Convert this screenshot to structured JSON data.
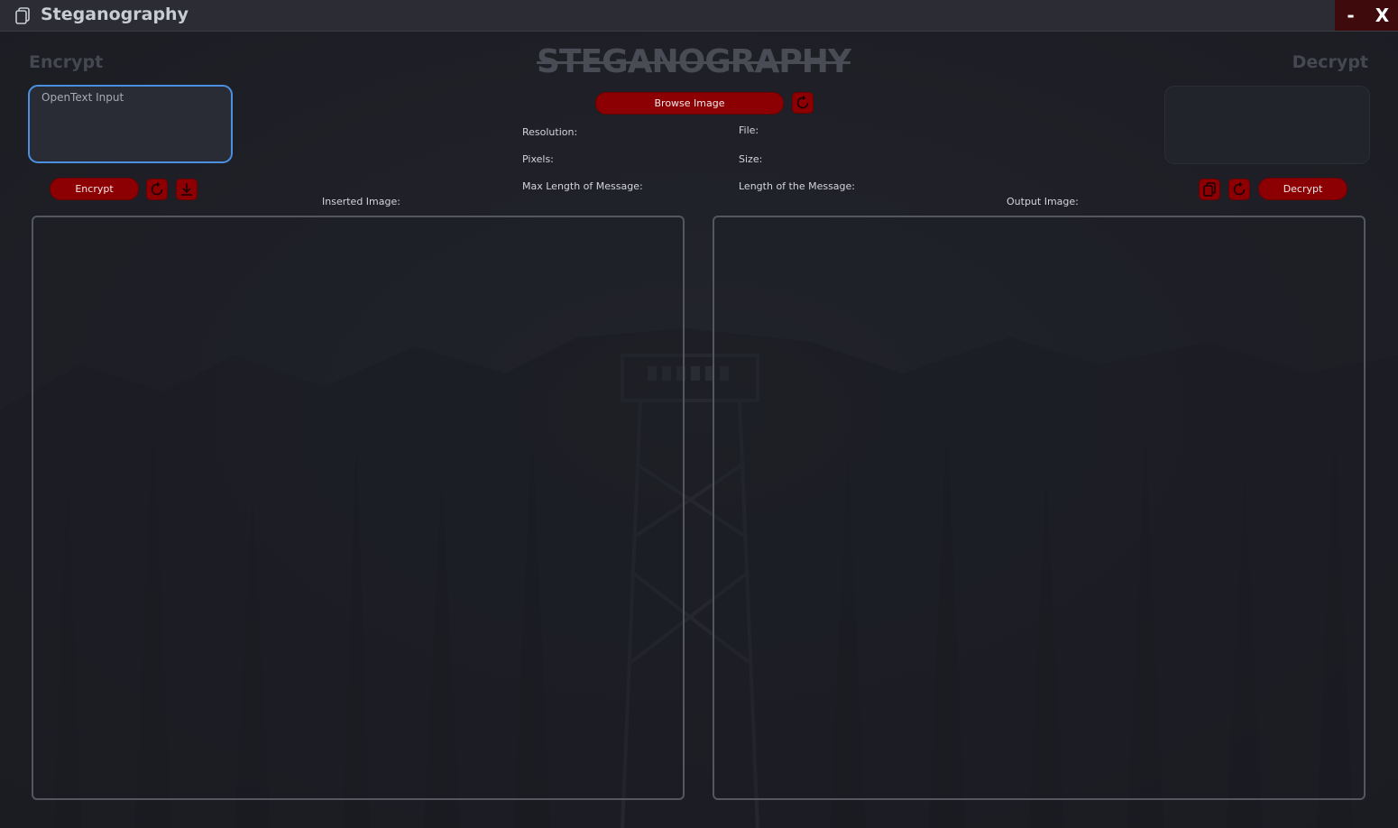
{
  "window": {
    "title": "Steganography",
    "minimize_label": "-",
    "close_label": "X"
  },
  "header": {
    "encrypt_heading": "Encrypt",
    "decrypt_heading": "Decrypt",
    "app_title": "STEGANOGRAPHY"
  },
  "encrypt": {
    "input_placeholder": "OpenText Input",
    "input_value": "",
    "encrypt_button": "Encrypt"
  },
  "center": {
    "browse_button": "Browse Image",
    "resolution_label": "Resolution:",
    "pixels_label": "Pixels:",
    "max_length_label": "Max Length of Message:",
    "file_label": "File:",
    "size_label": "Size:",
    "length_label": "Length of the Message:"
  },
  "decrypt": {
    "decrypt_button": "Decrypt",
    "output_text": ""
  },
  "panels": {
    "inserted_label": "Inserted Image:",
    "output_label": "Output Image:"
  },
  "icons": {
    "app": "copy-icon",
    "refresh": "refresh-icon",
    "download": "download-icon",
    "copy": "copy-icon"
  },
  "colors": {
    "accent_red": "#8c0004",
    "focus_blue": "#4a8fe0",
    "background": "#1f2027",
    "titlebar": "#2c2d34"
  }
}
